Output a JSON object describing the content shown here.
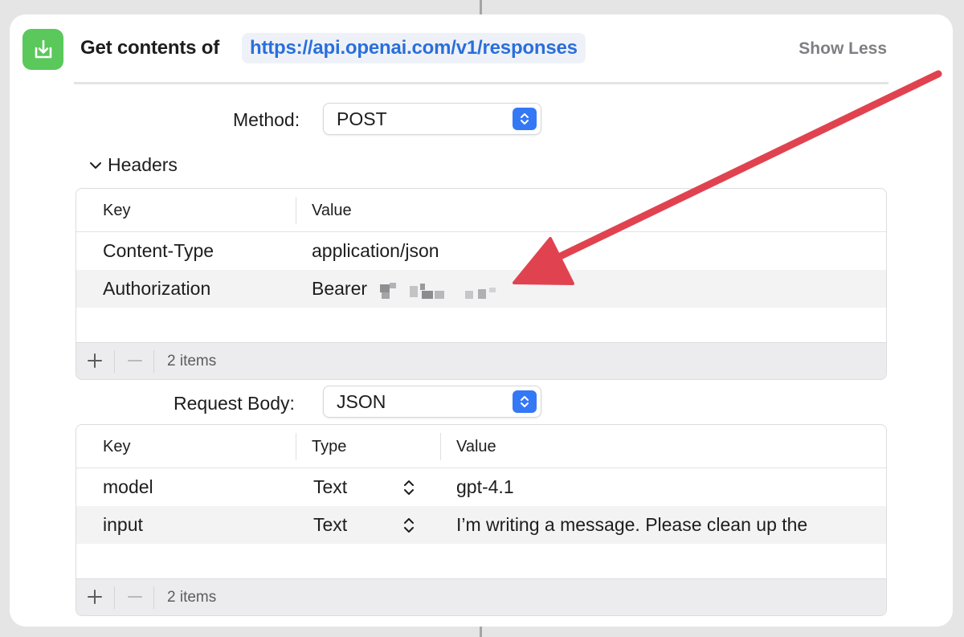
{
  "action": {
    "title": "Get contents of",
    "url": "https://api.openai.com/v1/responses",
    "show_less": "Show Less",
    "icon": "download-tray-icon",
    "icon_color": "#5ac85a"
  },
  "method": {
    "label": "Method:",
    "value": "POST"
  },
  "headers": {
    "section_label": "Headers",
    "columns": [
      "Key",
      "Value"
    ],
    "rows": [
      {
        "key": "Content-Type",
        "value": "application/json"
      },
      {
        "key": "Authorization",
        "value": "Bearer"
      }
    ],
    "count": "2 items"
  },
  "request_body": {
    "label": "Request Body:",
    "value": "JSON",
    "columns": [
      "Key",
      "Type",
      "Value"
    ],
    "rows": [
      {
        "key": "model",
        "type": "Text",
        "value": "gpt-4.1"
      },
      {
        "key": "input",
        "type": "Text",
        "value": "I’m writing a message. Please clean up the"
      }
    ],
    "count": "2 items"
  },
  "colors": {
    "accent_blue": "#3478f6",
    "link_blue": "#2a6fdb",
    "annotation_arrow": "#e0434f"
  }
}
